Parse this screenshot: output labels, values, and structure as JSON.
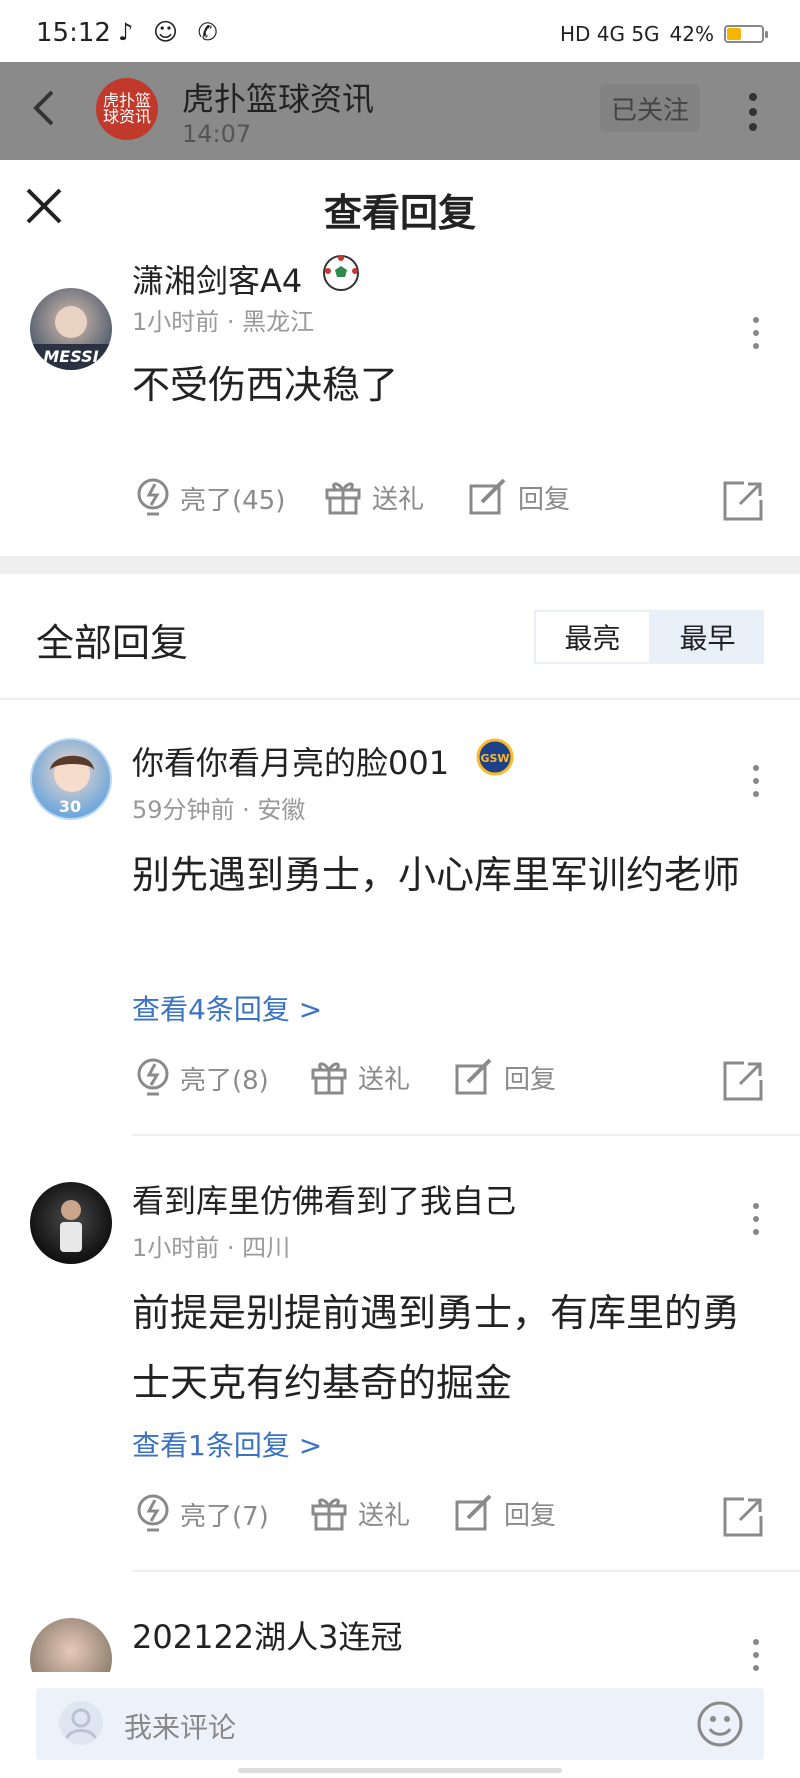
{
  "status_bar": {
    "time": "15:12",
    "network": "HD 4G 5G",
    "battery": "42%",
    "battery_level": 0.42
  },
  "background_header": {
    "title": "虎扑篮球资讯",
    "time": "14:07",
    "logo_text": "虎扑篮球资讯",
    "follow_label": "已关注"
  },
  "sheet": {
    "title": "查看回复"
  },
  "main_comment": {
    "username": "潇湘剑客A4",
    "meta": "1小时前 · 黑龙江",
    "text": "不受伤西决稳了",
    "avatar_text": "MESSI",
    "light_label": "亮了(45)",
    "gift_label": "送礼",
    "reply_label": "回复"
  },
  "replies_section": {
    "title": "全部回复",
    "sort_options": [
      "最亮",
      "最早"
    ],
    "selected_sort": "最亮"
  },
  "replies": [
    {
      "username": "你看你看月亮的脸001",
      "badge_text": "GSW",
      "avatar_number": "30",
      "meta": "59分钟前 · 安徽",
      "text": "别先遇到勇士，小心库里军训约老师",
      "view_more": "查看4条回复 >",
      "light_label": "亮了(8)",
      "gift_label": "送礼",
      "reply_label": "回复"
    },
    {
      "username": "看到库里仿佛看到了我自己",
      "meta": "1小时前 · 四川",
      "text": "前提是别提前遇到勇士，有库里的勇士天克有约基奇的掘金",
      "view_more": "查看1条回复 >",
      "light_label": "亮了(7)",
      "gift_label": "送礼",
      "reply_label": "回复"
    },
    {
      "username": "202122湖人3连冠",
      "meta": ""
    }
  ],
  "input_bar": {
    "placeholder": "我来评论"
  },
  "colors": {
    "link_blue": "#3a72c4",
    "overlay_gray": "#8a8a8a",
    "sort_bg": "#e9eff8",
    "input_bg": "#edf2fa"
  }
}
